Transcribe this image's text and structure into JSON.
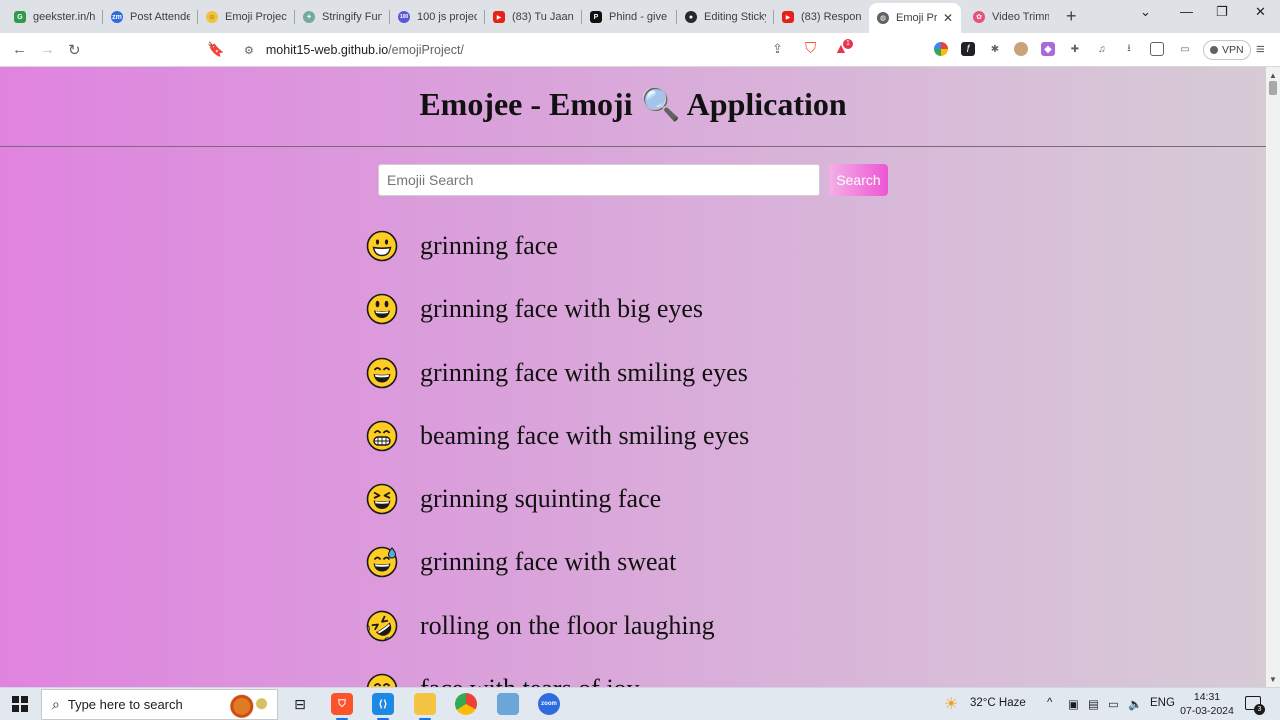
{
  "browser": {
    "tabs": [
      {
        "label": "geekster.in/h",
        "favicon_color": "#2e9b4f",
        "favicon_text": "G",
        "active": false
      },
      {
        "label": "Post Attende",
        "favicon_color": "#2d6cdf",
        "favicon_text": "zm",
        "active": false
      },
      {
        "label": "Emoji Project",
        "favicon_color": "#f2c13a",
        "favicon_text": "☺",
        "active": false
      },
      {
        "label": "Stringify Fun",
        "favicon_color": "#74aa9c",
        "favicon_text": "✦",
        "active": false
      },
      {
        "label": "100 js projec",
        "favicon_color": "#5b57d6",
        "favicon_text": "100",
        "active": false
      },
      {
        "label": "(83) Tu Jaane",
        "favicon_color": "#e62117",
        "favicon_text": "▶",
        "active": false
      },
      {
        "label": "Phind - give",
        "favicon_color": "#111111",
        "favicon_text": "P",
        "active": false
      },
      {
        "label": "Editing Sticky",
        "favicon_color": "#24292f",
        "favicon_text": "●",
        "active": false
      },
      {
        "label": "(83) Respons",
        "favicon_color": "#e62117",
        "favicon_text": "▶",
        "active": false
      },
      {
        "label": "Emoji Pr",
        "favicon_color": "#5f6368",
        "favicon_text": "◍",
        "active": true
      },
      {
        "label": "Video Trimm",
        "favicon_color": "#e9517a",
        "favicon_text": "✿",
        "active": false
      }
    ],
    "close_glyph": "✕",
    "new_tab_glyph": "+",
    "url_host": "mohit15-web.github.io",
    "url_path": "/emojiProject/",
    "vpn_label": "VPN",
    "brave_badge": "1"
  },
  "page": {
    "title": "Emojee - Emoji 🔍 Application",
    "search_placeholder": "Emojii Search",
    "search_value": "",
    "search_button_label": "Search",
    "emojis": [
      {
        "icon": "grinning-face",
        "name": "grinning face"
      },
      {
        "icon": "grinning-face-with-big-eyes",
        "name": "grinning face with big eyes"
      },
      {
        "icon": "grinning-face-with-smiling-eyes",
        "name": "grinning face with smiling eyes"
      },
      {
        "icon": "beaming-face-with-smiling-eyes",
        "name": "beaming face with smiling eyes"
      },
      {
        "icon": "grinning-squinting-face",
        "name": "grinning squinting face"
      },
      {
        "icon": "grinning-face-with-sweat",
        "name": "grinning face with sweat"
      },
      {
        "icon": "rolling-on-the-floor-laughing",
        "name": "rolling on the floor laughing"
      },
      {
        "icon": "face-with-tears-of-joy",
        "name": "face with tears of joy"
      }
    ]
  },
  "taskbar": {
    "search_placeholder": "Type here to search",
    "weather": "32°C  Haze",
    "language": "ENG",
    "time": "14:31",
    "date": "07-03-2024",
    "notification_count": "3"
  }
}
